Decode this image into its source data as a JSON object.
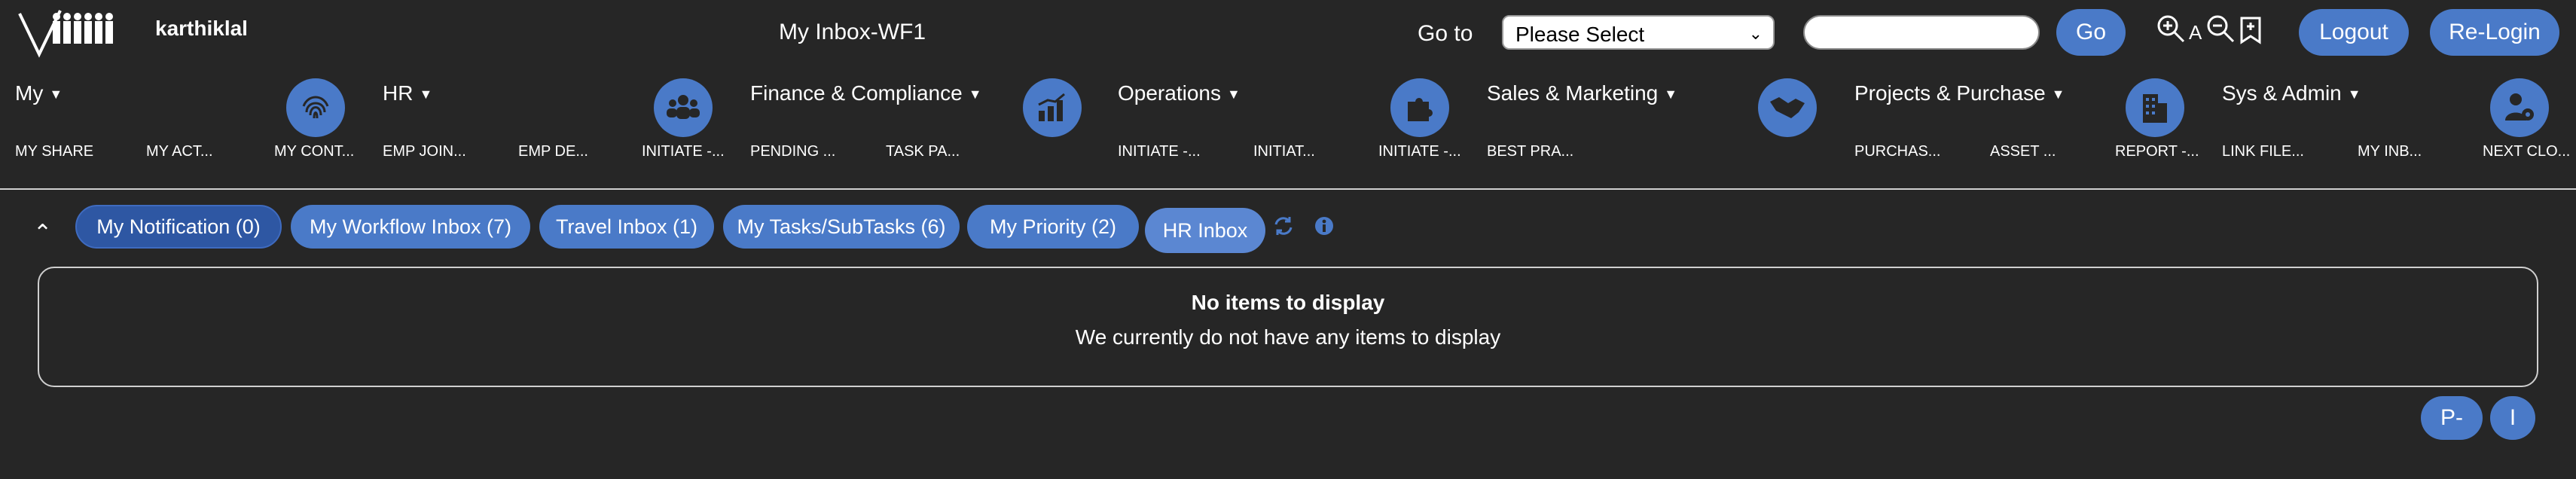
{
  "header": {
    "user_name": "karthiklal",
    "page_title": "My Inbox-WF1",
    "goto_label": "Go to",
    "select_value": "Please Select",
    "search_value": "",
    "go_label": "Go",
    "font_label": "A",
    "logout_label": "Logout",
    "relogin_label": "Re-Login"
  },
  "menus": [
    {
      "label": "My",
      "items": [
        "MY SHARE",
        "MY ACT...",
        "MY CONT..."
      ]
    },
    {
      "label": "HR",
      "items": [
        "EMP JOIN...",
        "EMP DE...",
        "INITIATE -..."
      ]
    },
    {
      "label": "Finance & Compliance",
      "items": [
        "PENDING ...",
        "TASK PA..."
      ]
    },
    {
      "label": "Operations",
      "items": [
        "INITIATE -...",
        "INITIAT...",
        "INITIATE -..."
      ]
    },
    {
      "label": "Sales & Marketing",
      "items": [
        "BEST PRA..."
      ]
    },
    {
      "label": "Projects & Purchase",
      "items": [
        "PURCHAS...",
        "ASSET ...",
        "REPORT -..."
      ]
    },
    {
      "label": "Sys & Admin",
      "items": [
        "LINK FILE...",
        "MY INB...",
        "NEXT CLO..."
      ]
    }
  ],
  "nav_icons": [
    "fingerprint-icon",
    "users-icon",
    "bar-chart-icon",
    "puzzle-icon",
    "handshake-icon",
    "building-icon",
    "user-gear-icon"
  ],
  "tabs": [
    {
      "label": "My Notification (0)"
    },
    {
      "label": "My Workflow Inbox (7)"
    },
    {
      "label": "Travel Inbox (1)"
    },
    {
      "label": "My Tasks/SubTasks (6)"
    },
    {
      "label": "My Priority (2)"
    },
    {
      "label": "HR Inbox"
    }
  ],
  "empty": {
    "title": "No items to display",
    "message": "We currently do not have any items to display"
  },
  "pager": {
    "prev_label": "P-",
    "next_label": "I"
  },
  "colors": {
    "background": "#262626",
    "accent": "#4a7ac8",
    "accent_dark": "#2e57a3"
  }
}
